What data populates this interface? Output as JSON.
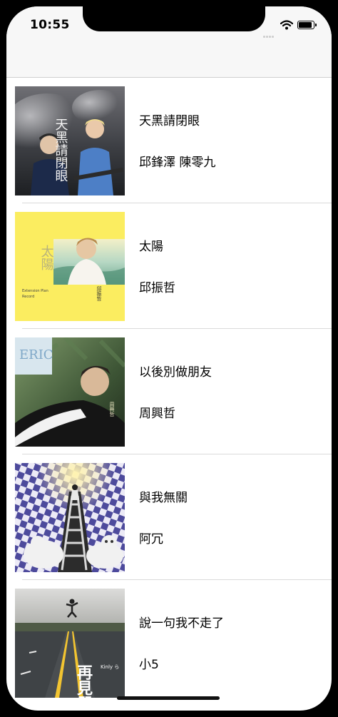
{
  "status_bar": {
    "time": "10:55",
    "signal_icon": "signal-bars-icon",
    "wifi_icon": "wifi-icon",
    "battery_icon": "battery-icon",
    "battery_level": 0.9
  },
  "songs": [
    {
      "title": "天黑請閉眼",
      "artist": "邱鋒澤 陳零九",
      "artwork_icon": "album-artwork-image"
    },
    {
      "title": "太陽",
      "artist": "邱振哲",
      "artwork_icon": "album-artwork-image"
    },
    {
      "title": "以後別做朋友",
      "artist": "周興哲",
      "artwork_icon": "album-artwork-image"
    },
    {
      "title": "與我無關",
      "artist": "阿冗",
      "artwork_icon": "album-artwork-image"
    },
    {
      "title": "說一句我不走了",
      "artist": "小5",
      "artwork_icon": "album-artwork-image"
    }
  ],
  "artwork_text": {
    "cover1": "天黑請閉眼",
    "cover2_title": "太陽",
    "cover2_sub": "Extension Plan",
    "cover2_sub2": "Record",
    "cover2_name": "邱振哲",
    "cover3_mark": "ERIC",
    "cover3_name": "周興哲",
    "cover5_title": "再見單純",
    "cover5_sign": "Kinly ら"
  }
}
